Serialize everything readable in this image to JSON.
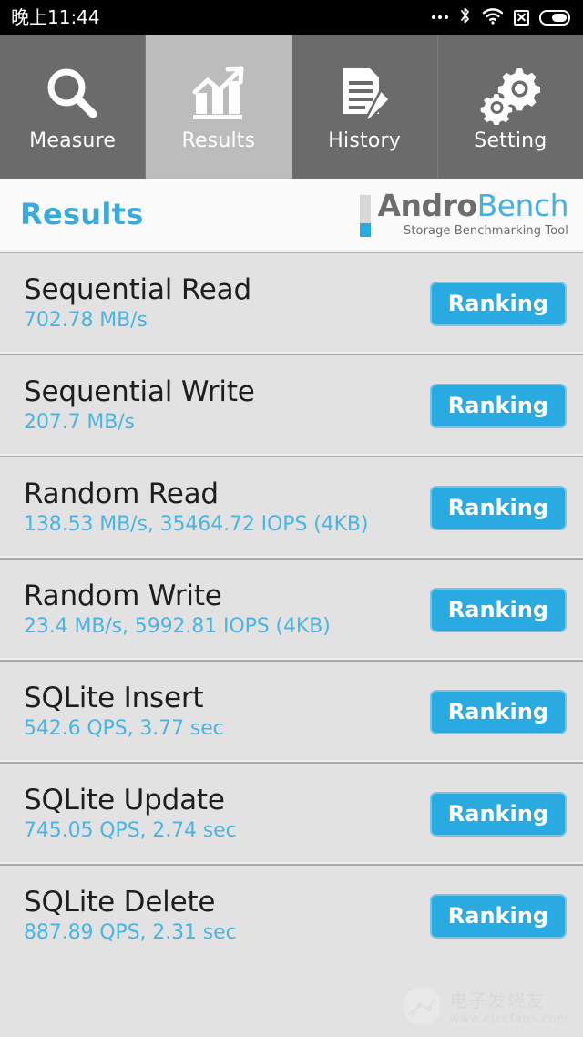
{
  "statusbar": {
    "time": "晚上11:44",
    "icons": [
      {
        "name": "more-dots-icon"
      },
      {
        "name": "bluetooth-icon"
      },
      {
        "name": "wifi-icon"
      },
      {
        "name": "no-sim-icon"
      },
      {
        "name": "battery-icon"
      }
    ]
  },
  "tabs": [
    {
      "label": "Measure",
      "icon": "search-icon",
      "active": false
    },
    {
      "label": "Results",
      "icon": "bar-chart-icon",
      "active": true
    },
    {
      "label": "History",
      "icon": "document-edit-icon",
      "active": false
    },
    {
      "label": "Setting",
      "icon": "gears-icon",
      "active": false
    }
  ],
  "header": {
    "title": "Results",
    "brand_first": "Andro",
    "brand_second": "Bench",
    "brand_tagline": "Storage Benchmarking Tool"
  },
  "results": [
    {
      "title": "Sequential Read",
      "value": "702.78 MB/s",
      "button": "Ranking"
    },
    {
      "title": "Sequential Write",
      "value": "207.7 MB/s",
      "button": "Ranking"
    },
    {
      "title": "Random Read",
      "value": "138.53 MB/s, 35464.72 IOPS (4KB)",
      "button": "Ranking"
    },
    {
      "title": "Random Write",
      "value": "23.4 MB/s, 5992.81 IOPS (4KB)",
      "button": "Ranking"
    },
    {
      "title": "SQLite Insert",
      "value": "542.6 QPS, 3.77 sec",
      "button": "Ranking"
    },
    {
      "title": "SQLite Update",
      "value": "745.05 QPS, 2.74 sec",
      "button": "Ranking"
    },
    {
      "title": "SQLite Delete",
      "value": "887.89 QPS, 2.31 sec",
      "button": "Ranking"
    }
  ],
  "watermark": {
    "cn": "电子发烧友",
    "url": "www.elecfans.com"
  },
  "colors": {
    "accent_blue": "#29abe2",
    "value_blue": "#4cb4e0",
    "title_blue": "#3aaada",
    "tabbar_inactive": "#6b6b6b",
    "tabbar_active": "#bcbcbc",
    "list_background": "#e2e2e2",
    "header_background": "#fbfbfb",
    "statusbar_background": "#000000"
  }
}
